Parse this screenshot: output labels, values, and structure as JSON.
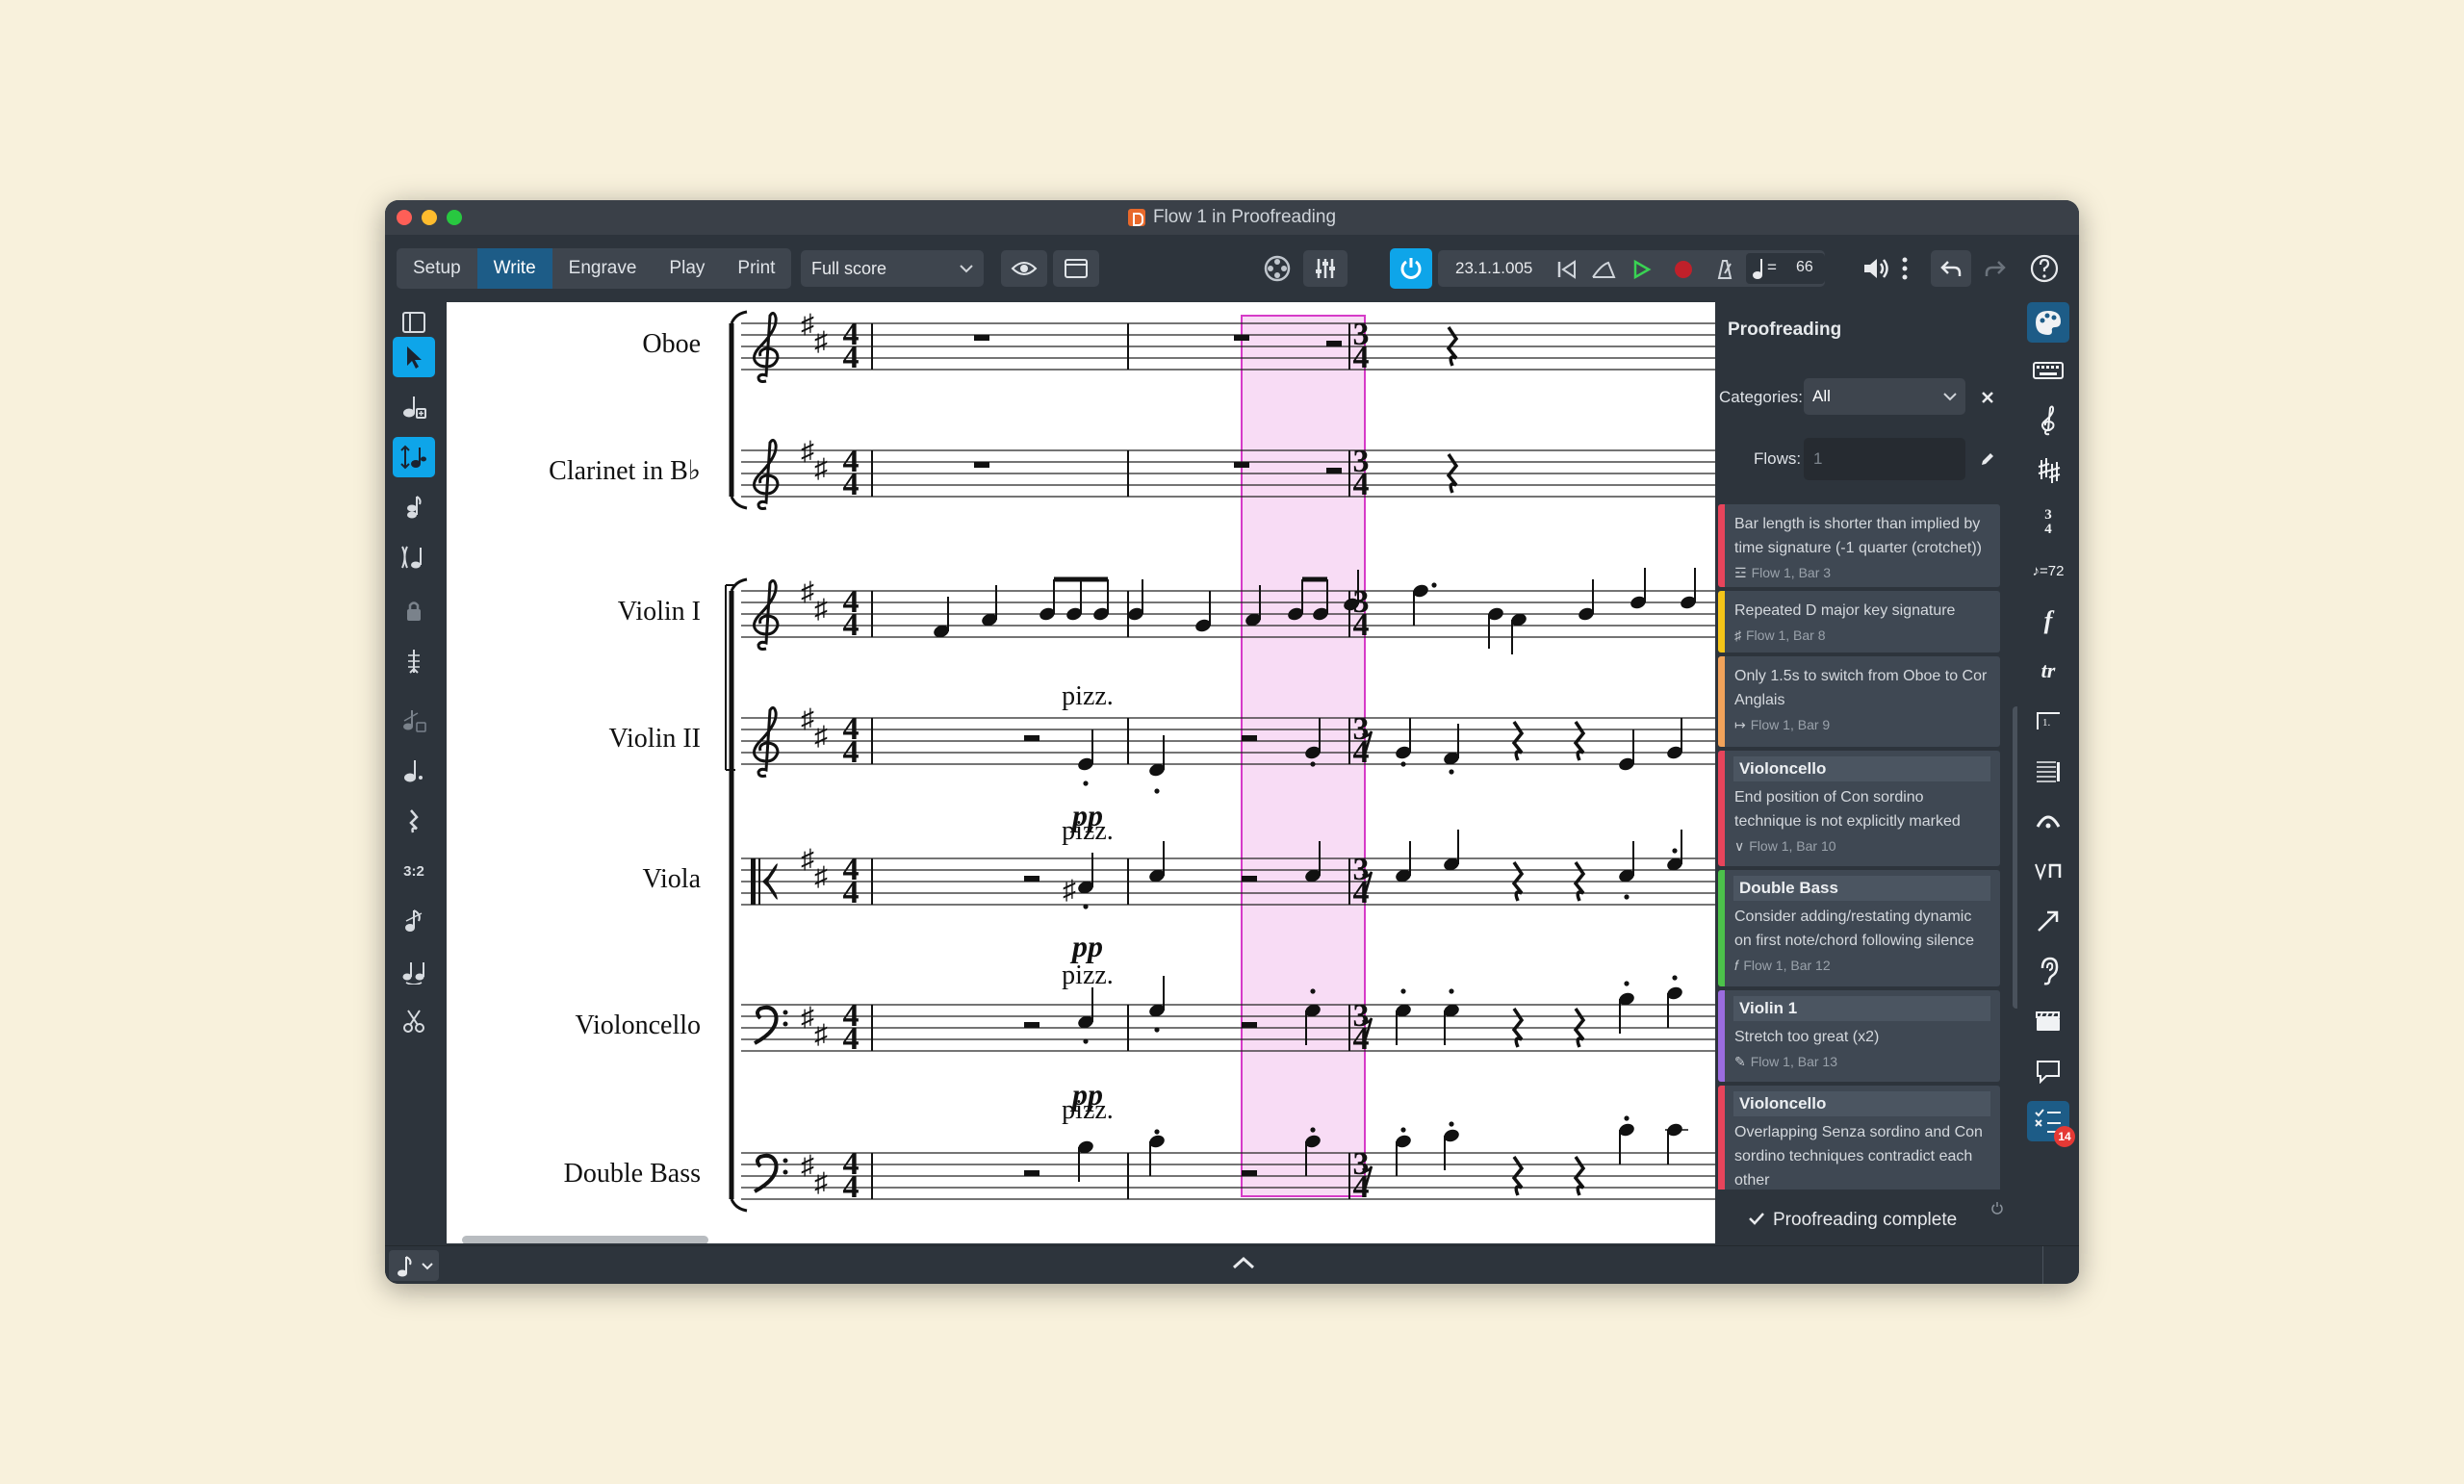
{
  "window": {
    "title": "Flow 1 in Proofreading"
  },
  "toolbar": {
    "modes": [
      "Setup",
      "Write",
      "Engrave",
      "Play",
      "Print"
    ],
    "active_mode": "Write",
    "layout_select": "Full score",
    "timecode": "23.1.1.005",
    "tempo_value": "66",
    "tempo_equals": "="
  },
  "left_tools": [
    "toggle-panel-icon",
    "select-icon",
    "note-input-icon",
    "insert-mode-icon",
    "chord-icon",
    "voice-icon",
    "lock-icon",
    "caret-icon",
    "grace-note-icon",
    "dotted-note-icon",
    "rest-icon",
    "tuplet-icon",
    "slash-note-icon",
    "tie-icon",
    "scissors-icon"
  ],
  "left_tool_labels": {
    "tuplet": "3:2"
  },
  "score": {
    "staves": [
      "Oboe",
      "Clarinet in B♭",
      "Violin I",
      "Violin II",
      "Viola",
      "Violoncello",
      "Double Bass"
    ],
    "time_signature": "4/4",
    "key": "D major",
    "technique": "pizz.",
    "dynamic": "pp",
    "highlight_color": "#d63bc8"
  },
  "panel": {
    "title": "Proofreading",
    "categories_label": "Categories:",
    "categories_value": "All",
    "flows_label": "Flows:",
    "flows_placeholder": "1",
    "items": [
      {
        "color": "#e8445b",
        "header": "",
        "text": "Bar length is shorter than implied by time signature (-1 quarter (crotchet))",
        "location": "Flow 1, Bar 3",
        "icon": "bar-icon",
        "icon_glyph": "☲"
      },
      {
        "color": "#f5c518",
        "header": "",
        "text": "Repeated D major key signature",
        "location": "Flow 1, Bar 8",
        "icon": "key-signature-icon",
        "icon_glyph": "♯"
      },
      {
        "color": "#f2a35a",
        "header": "",
        "text": "Only 1.5s to switch from Oboe to Cor Anglais",
        "location": "Flow 1, Bar 9",
        "icon": "instrument-change-icon",
        "icon_glyph": "↦"
      },
      {
        "color": "#e8445b",
        "header": "Violoncello",
        "text": "End position of Con sordino technique is not explicitly marked",
        "location": "Flow 1, Bar 10",
        "icon": "technique-icon",
        "icon_glyph": "∨"
      },
      {
        "color": "#4cc24a",
        "header": "Double Bass",
        "text": "Consider adding/restating dynamic on first note/chord following silence",
        "location": "Flow 1, Bar 12",
        "icon": "dynamic-icon",
        "icon_glyph": "𝑓"
      },
      {
        "color": "#9b6ce0",
        "header": "Violin 1",
        "text": "Stretch too great (x2)",
        "location": "Flow 1, Bar 13",
        "icon": "stretch-icon",
        "icon_glyph": "✎"
      },
      {
        "color": "#e8445b",
        "header": "Violoncello",
        "text": "Overlapping Senza sordino and Con sordino techniques contradict each other",
        "location": "",
        "icon": "technique-icon",
        "icon_glyph": "∨"
      }
    ],
    "footer": "Proofreading complete"
  },
  "right_tools": [
    "palette-icon",
    "keyboard-icon",
    "clef-icon",
    "key-signature-icon",
    "time-signature-icon",
    "tempo-icon",
    "dynamics-icon",
    "ornaments-icon",
    "repeat-icon",
    "bars-icon",
    "fermata-icon",
    "technique-icon",
    "line-icon",
    "ear-icon",
    "video-icon",
    "comment-icon",
    "proofreading-icon"
  ],
  "right_tool_labels": {
    "tempo": "♪=72",
    "proofreading_count": "14"
  }
}
